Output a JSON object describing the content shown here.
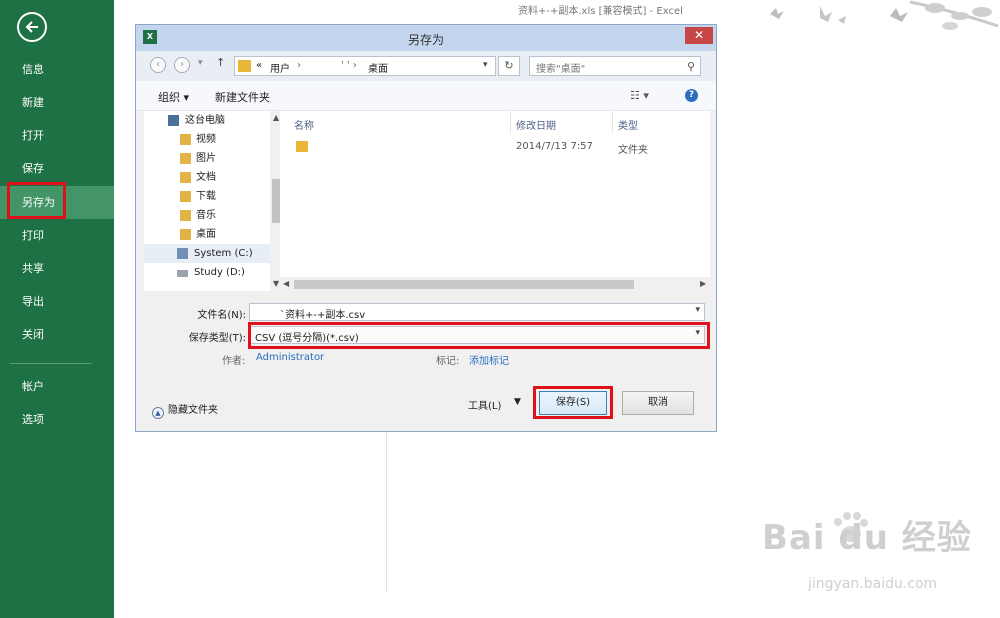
{
  "app": {
    "window_title": "资料+-+副本.xls  [兼容模式] - Excel"
  },
  "sidebar": {
    "items": [
      {
        "label": "信息"
      },
      {
        "label": "新建"
      },
      {
        "label": "打开"
      },
      {
        "label": "保存"
      },
      {
        "label": "另存为",
        "active": true
      },
      {
        "label": "打印"
      },
      {
        "label": "共享"
      },
      {
        "label": "导出"
      },
      {
        "label": "关闭"
      },
      {
        "label": "帐户"
      },
      {
        "label": "选项"
      }
    ],
    "colors": {
      "background": "#1e7145",
      "active": "#439467"
    }
  },
  "dialog": {
    "title": "另存为",
    "address": {
      "prefix": "«",
      "crumb1": "用户",
      "sep": "›",
      "crumb2": "' ' ›",
      "crumb3": "桌面"
    },
    "search_placeholder": "搜索\"桌面\"",
    "toolbar": {
      "organize": "组织 ▾",
      "new_folder": "新建文件夹"
    },
    "nav_tree": [
      {
        "label": "这台电脑",
        "icon": "computer-icon"
      },
      {
        "label": "视频",
        "icon": "videos-folder-icon"
      },
      {
        "label": "图片",
        "icon": "pictures-folder-icon"
      },
      {
        "label": "文档",
        "icon": "documents-folder-icon"
      },
      {
        "label": "下载",
        "icon": "downloads-folder-icon"
      },
      {
        "label": "音乐",
        "icon": "music-folder-icon"
      },
      {
        "label": "桌面",
        "icon": "desktop-folder-icon"
      },
      {
        "label": "System (C:)",
        "icon": "system-drive-icon"
      },
      {
        "label": "Study (D:)",
        "icon": "drive-icon"
      }
    ],
    "columns": {
      "name": "名称",
      "modified": "修改日期",
      "type": "类型"
    },
    "files": [
      {
        "name": "",
        "modified": "2014/7/13 7:57",
        "type": "文件夹"
      }
    ],
    "filename_label": "文件名(N):",
    "filename_value": "`资料+-+副本.csv",
    "filetype_label": "保存类型(T):",
    "filetype_value": "CSV (逗号分隔)(*.csv)",
    "author_label": "作者:",
    "author_value": "Administrator",
    "tags_label": "标记:",
    "tags_value": "添加标记",
    "hide_folders": "隐藏文件夹",
    "tools": "工具(L)",
    "save": "保存(S)",
    "cancel": "取消"
  },
  "watermark": {
    "main": "Bai du 经验",
    "sub": "jingyan.baidu.com"
  },
  "highlight_color": "#e0111b"
}
